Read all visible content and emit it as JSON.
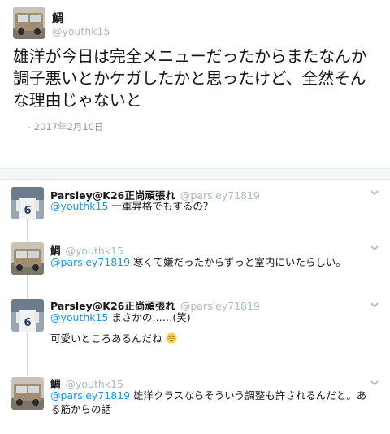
{
  "main_tweet": {
    "author_name": "鯛",
    "author_handle": "@youthk15",
    "text": "雄洋が今日は完全メニューだったからまたなんか調子悪いとかケガしたかと思ったけど、全然そんな理由じゃないと",
    "date": "- 2017年2月10日"
  },
  "replies": [
    {
      "author_name": "Parsley@K26正尚頑張れ",
      "author_handle": "@parsley71819",
      "mention": "@youthk15",
      "text": " 一軍昇格でもするの？",
      "extra_text": "",
      "avatar": "jersey-6"
    },
    {
      "author_name": "鯛",
      "author_handle": "@youthk15",
      "mention": "@parsley71819",
      "text": " 寒くて嫌だったからずっと室内にいたらしい。",
      "extra_text": "",
      "avatar": "car"
    },
    {
      "author_name": "Parsley@K26正尚頑張れ",
      "author_handle": "@parsley71819",
      "mention": "@youthk15",
      "text": " まさかの……(笑)",
      "extra_text": "可愛いところあるんだね",
      "avatar": "jersey-6"
    },
    {
      "author_name": "鯛",
      "author_handle": "@youthk15",
      "mention": "@parsley71819",
      "text": " 雄洋クラスならそういう調整も許されるんだと。ある筋からの話",
      "extra_text": "",
      "avatar": "car"
    }
  ],
  "jersey_number": "6",
  "icons": {
    "chevron": "chevron-down-icon",
    "emoji": "grinning-face-icon"
  },
  "colors": {
    "mention": "#1b95e0",
    "handle": "#aab8c2",
    "thread_line": "#ccd6dd"
  }
}
